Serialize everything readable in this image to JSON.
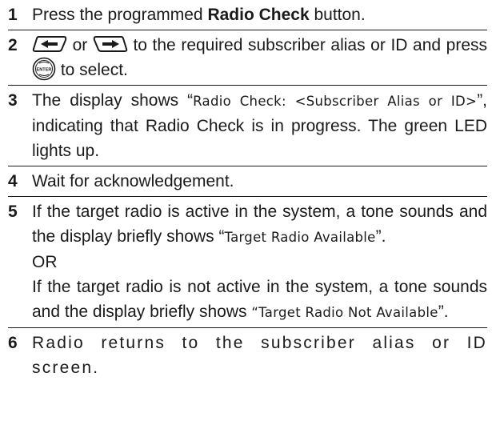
{
  "steps": [
    {
      "num": "1",
      "pre": "Press the programmed ",
      "bold": "Radio Check",
      "post": " button."
    },
    {
      "num": "2",
      "or_text": " or ",
      "mid": " to the required subscriber alias or ID and press ",
      "post": " to select.",
      "icons": [
        "left-arrow-key",
        "right-arrow-key",
        "enter-key"
      ],
      "enter_label": "ENTER"
    },
    {
      "num": "3",
      "pre": "The display shows “",
      "display": "Radio Check: <Subscriber Alias or ID>",
      "post": "”, indicating that Radio Check is in progress. The green LED lights up."
    },
    {
      "num": "4",
      "text": "Wait for acknowledgement."
    },
    {
      "num": "5",
      "pre1": "If the target radio is active in the system, a tone sounds and the display briefly shows “",
      "display1": "Target Radio Available",
      "post1": "”.",
      "or": "OR",
      "pre2": "If the target radio is not active in the system, a tone sounds and the display briefly shows ",
      "display2": "“Target Radio Not Available",
      "post2": "”."
    },
    {
      "num": "6",
      "text": "Radio returns to the subscriber alias or ID screen."
    }
  ]
}
